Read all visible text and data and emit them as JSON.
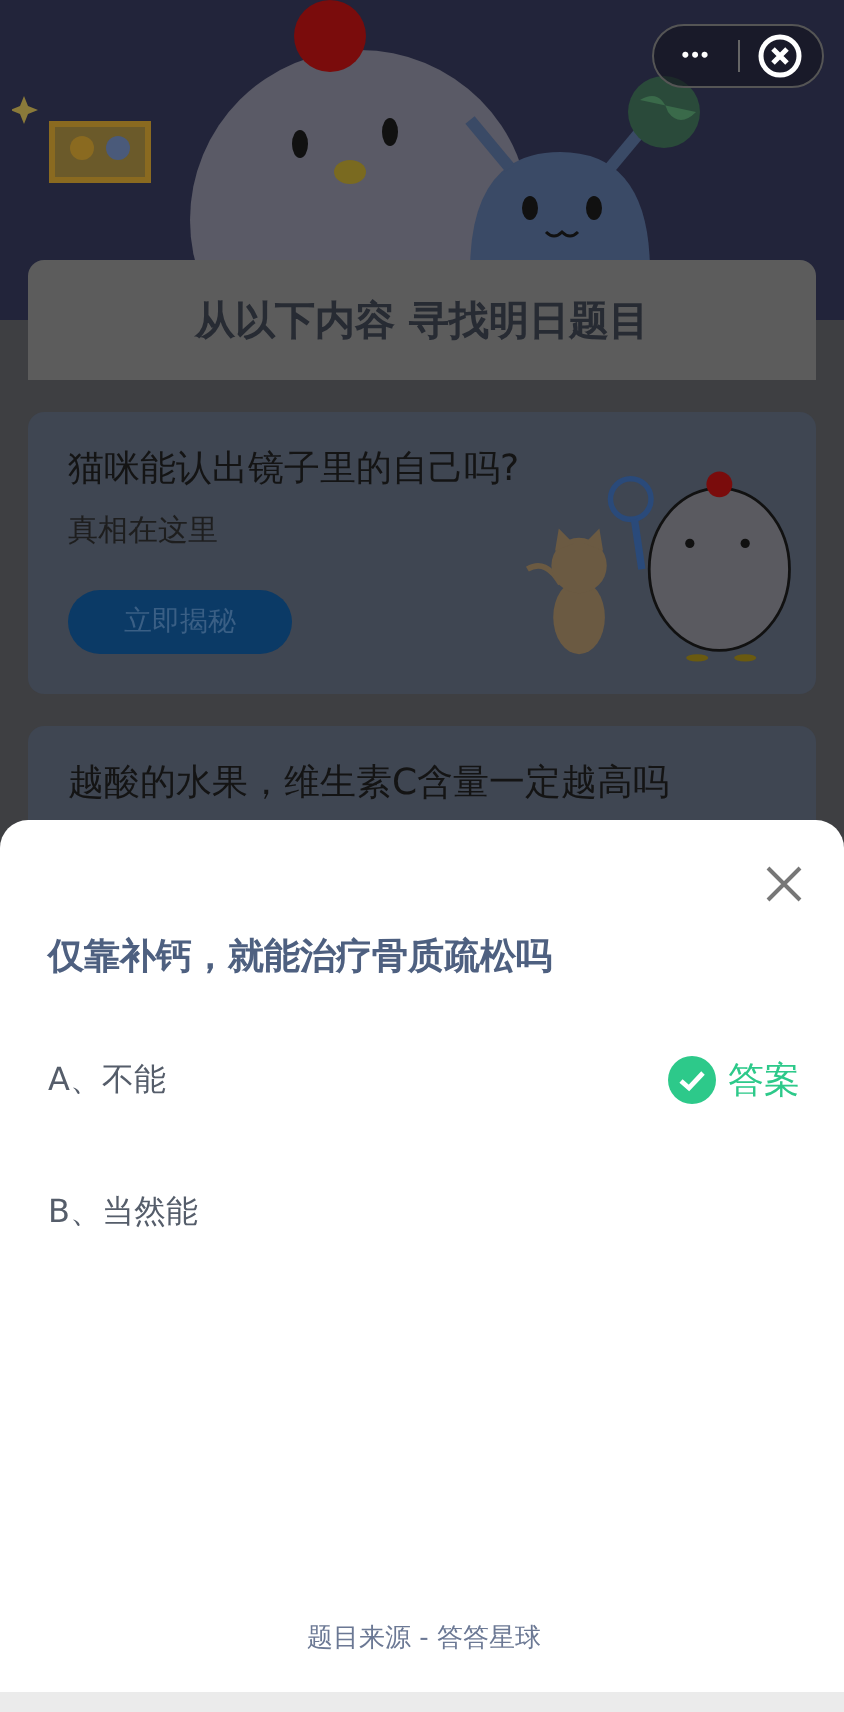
{
  "capsule": {
    "more": "•••"
  },
  "banner": {
    "title": "从以下内容  寻找明日题目"
  },
  "cards": [
    {
      "title": "猫咪能认出镜子里的自己吗?",
      "subtitle": "真相在这里",
      "button": "立即揭秘"
    },
    {
      "title": "越酸的水果，维生素C含量一定越高吗"
    }
  ],
  "sheet": {
    "question": "仅靠补钙，就能治疗骨质疏松吗",
    "options": [
      {
        "label": "A、不能",
        "correct": true,
        "badge": "答案"
      },
      {
        "label": "B、当然能",
        "correct": false
      }
    ],
    "footer": "题目来源 - 答答星球"
  }
}
